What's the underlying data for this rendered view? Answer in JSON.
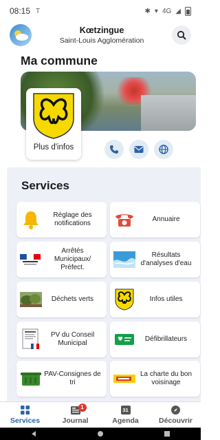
{
  "status_bar": {
    "time": "08:15",
    "tiny_icon": "T",
    "network": "4G"
  },
  "header": {
    "town": "Kœtzingue",
    "agglomeration": "Saint-Louis Agglomération"
  },
  "commune": {
    "title": "Ma commune",
    "more_info": "Plus d'infos"
  },
  "services": {
    "title": "Services",
    "tiles": [
      {
        "label": "Réglage des notifications",
        "icon": "bell-icon"
      },
      {
        "label": "Annuaire",
        "icon": "phone-icon"
      },
      {
        "label": "Arrêtés Municipaux/ Préfect.",
        "icon": "arrete-icon"
      },
      {
        "label": "Résultats d'analyses d'eau",
        "icon": "water-icon"
      },
      {
        "label": "Déchets verts",
        "icon": "green-waste-icon"
      },
      {
        "label": "Infos utiles",
        "icon": "crest-icon"
      },
      {
        "label": "PV du Conseil Municipal",
        "icon": "document-icon"
      },
      {
        "label": "Défibrillateurs",
        "icon": "defibrillator-icon"
      },
      {
        "label": "PAV-Consignes de tri",
        "icon": "bin-icon"
      },
      {
        "label": "La charte du bon voisinage",
        "icon": "charter-icon"
      }
    ]
  },
  "bottom_nav": [
    {
      "label": "Services",
      "icon": "grid-icon",
      "active": true
    },
    {
      "label": "Journal",
      "icon": "journal-icon",
      "badge": "1"
    },
    {
      "label": "Agenda",
      "icon": "calendar-icon",
      "day": "31"
    },
    {
      "label": "Découvrir",
      "icon": "compass-icon"
    }
  ],
  "colors": {
    "accent": "#2c63a6",
    "panel": "#eef0f7",
    "crest_yellow": "#f6d900"
  }
}
